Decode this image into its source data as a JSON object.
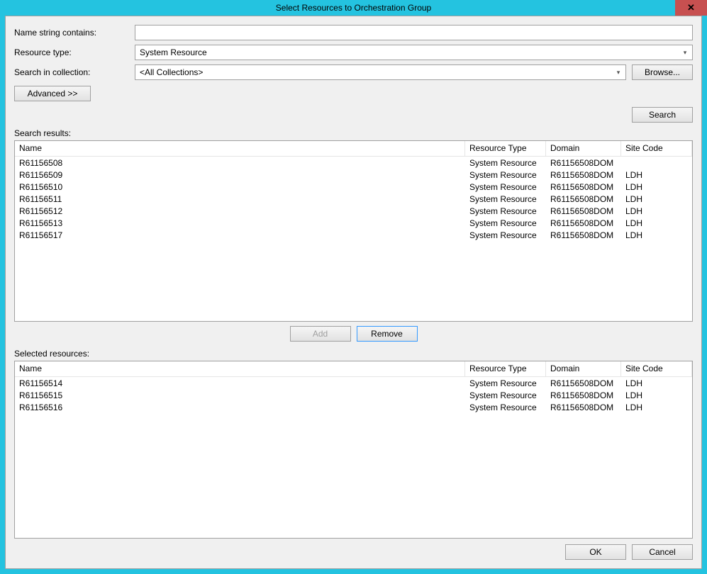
{
  "titlebar": {
    "title": "Select Resources to Orchestration Group",
    "close": "✕"
  },
  "labels": {
    "name_contains": "Name string contains:",
    "resource_type": "Resource type:",
    "search_in_collection": "Search in collection:",
    "search_results": "Search results:",
    "selected_resources": "Selected resources:"
  },
  "fields": {
    "name_contains_value": "",
    "resource_type_value": "System Resource",
    "collection_value": "<All Collections>"
  },
  "buttons": {
    "browse": "Browse...",
    "advanced": "Advanced >>",
    "search": "Search",
    "add": "Add",
    "remove": "Remove",
    "ok": "OK",
    "cancel": "Cancel"
  },
  "columns": {
    "name": "Name",
    "resource_type": "Resource Type",
    "domain": "Domain",
    "site_code": "Site Code"
  },
  "search_results_rows": [
    {
      "name": "R61156508",
      "type": "System Resource",
      "domain": "R61156508DOM",
      "site": ""
    },
    {
      "name": "R61156509",
      "type": "System Resource",
      "domain": "R61156508DOM",
      "site": "LDH"
    },
    {
      "name": "R61156510",
      "type": "System Resource",
      "domain": "R61156508DOM",
      "site": "LDH"
    },
    {
      "name": "R61156511",
      "type": "System Resource",
      "domain": "R61156508DOM",
      "site": "LDH"
    },
    {
      "name": "R61156512",
      "type": "System Resource",
      "domain": "R61156508DOM",
      "site": "LDH"
    },
    {
      "name": "R61156513",
      "type": "System Resource",
      "domain": "R61156508DOM",
      "site": "LDH"
    },
    {
      "name": "R61156517",
      "type": "System Resource",
      "domain": "R61156508DOM",
      "site": "LDH"
    }
  ],
  "selected_rows": [
    {
      "name": "R61156514",
      "type": "System Resource",
      "domain": "R61156508DOM",
      "site": "LDH"
    },
    {
      "name": "R61156515",
      "type": "System Resource",
      "domain": "R61156508DOM",
      "site": "LDH"
    },
    {
      "name": "R61156516",
      "type": "System Resource",
      "domain": "R61156508DOM",
      "site": "LDH"
    }
  ]
}
